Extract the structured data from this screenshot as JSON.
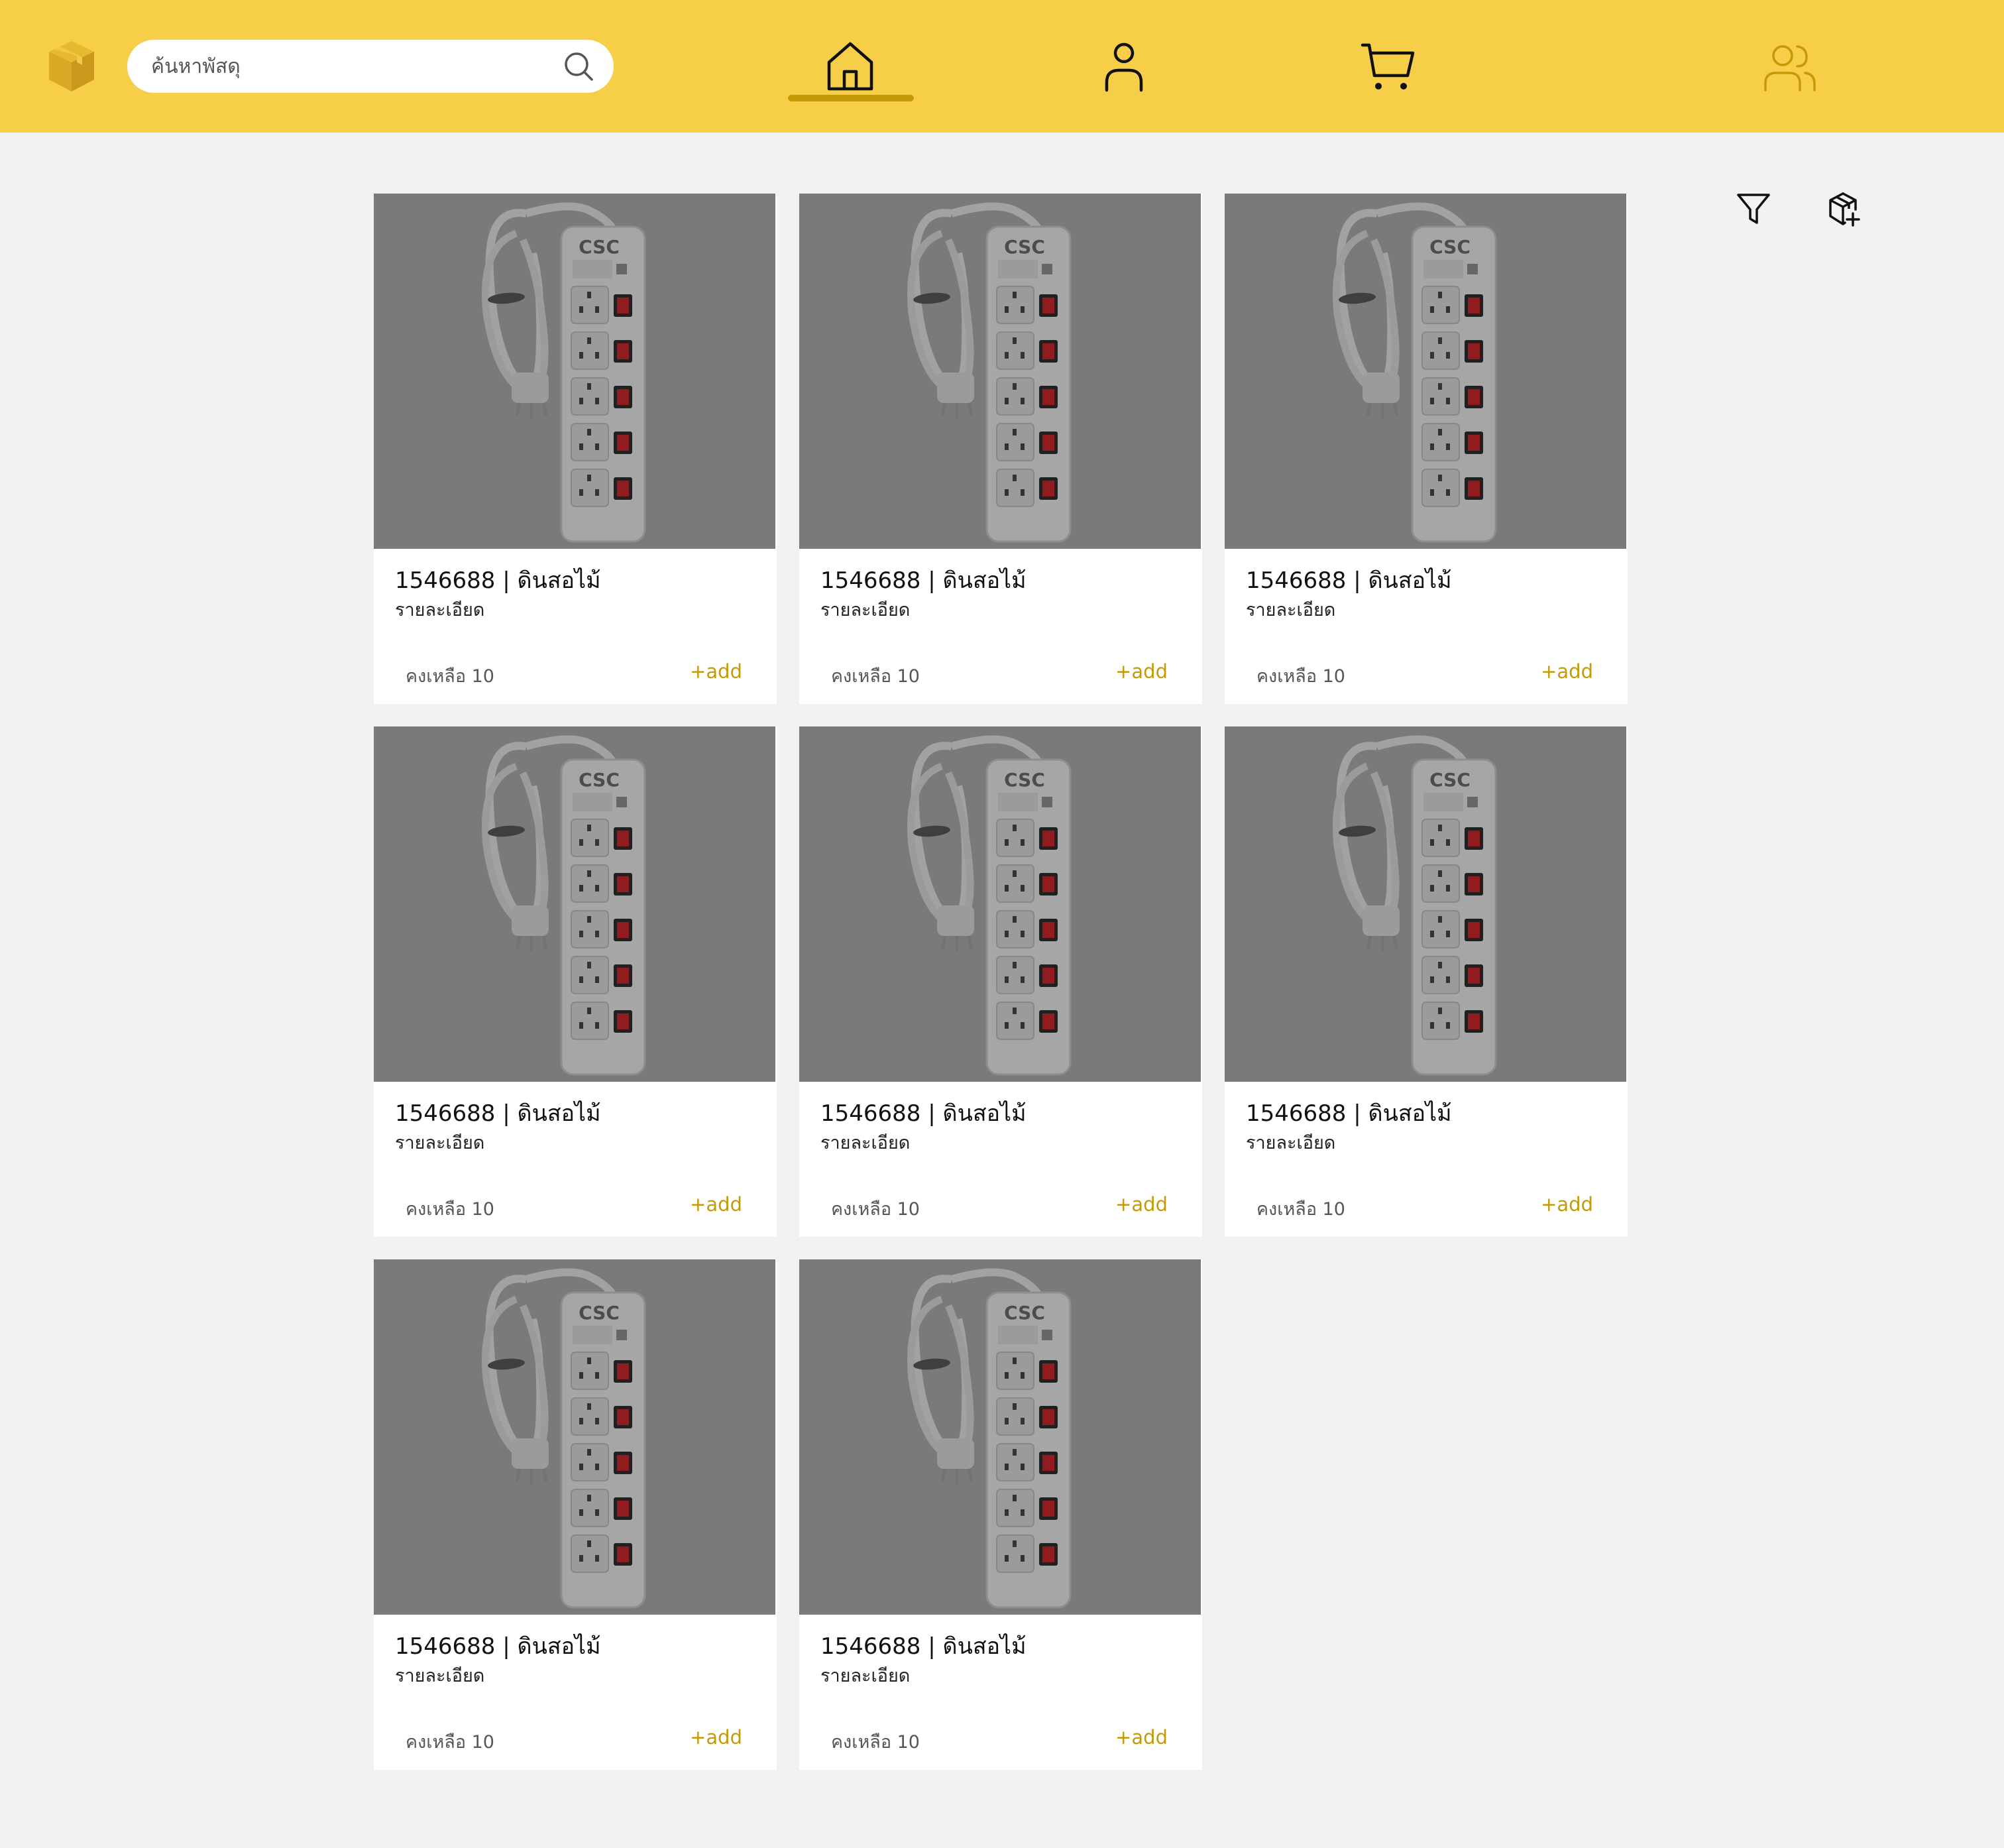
{
  "header": {
    "logo_icon": "box-icon",
    "search": {
      "placeholder": "ค้นหาพัสดุ",
      "value": "",
      "icon": "search-icon"
    },
    "nav": [
      {
        "name": "home",
        "icon": "home-icon",
        "active": true
      },
      {
        "name": "profile",
        "icon": "user-icon",
        "active": false
      },
      {
        "name": "cart",
        "icon": "cart-icon",
        "active": false
      },
      {
        "name": "users",
        "icon": "users-icon",
        "active": false
      }
    ],
    "colors": {
      "bar": "#f6ce47",
      "accent": "#c49a06"
    }
  },
  "toolbar": {
    "filter_icon": "filter-icon",
    "add_item_icon": "add-box-icon"
  },
  "products": [
    {
      "title": "1546688 | ดินสอไม้",
      "description": "รายละเอียด",
      "stock": "คงเหลือ 10",
      "add_label": "+add"
    },
    {
      "title": "1546688 | ดินสอไม้",
      "description": "รายละเอียด",
      "stock": "คงเหลือ 10",
      "add_label": "+add"
    },
    {
      "title": "1546688 | ดินสอไม้",
      "description": "รายละเอียด",
      "stock": "คงเหลือ 10",
      "add_label": "+add"
    },
    {
      "title": "1546688 | ดินสอไม้",
      "description": "รายละเอียด",
      "stock": "คงเหลือ 10",
      "add_label": "+add"
    },
    {
      "title": "1546688 | ดินสอไม้",
      "description": "รายละเอียด",
      "stock": "คงเหลือ 10",
      "add_label": "+add"
    },
    {
      "title": "1546688 | ดินสอไม้",
      "description": "รายละเอียด",
      "stock": "คงเหลือ 10",
      "add_label": "+add"
    },
    {
      "title": "1546688 | ดินสอไม้",
      "description": "รายละเอียด",
      "stock": "คงเหลือ 10",
      "add_label": "+add"
    },
    {
      "title": "1546688 | ดินสอไม้",
      "description": "รายละเอียด",
      "stock": "คงเหลือ 10",
      "add_label": "+add"
    }
  ]
}
